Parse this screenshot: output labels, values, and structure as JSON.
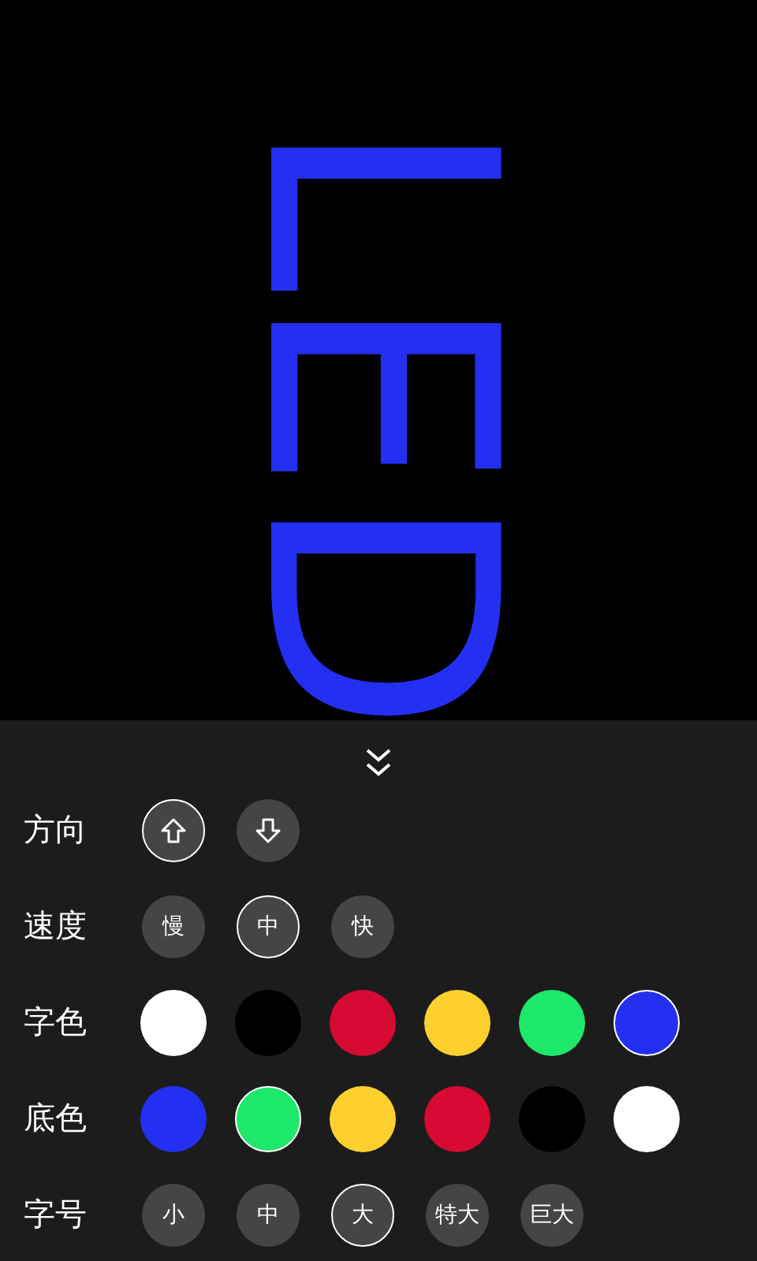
{
  "marquee": {
    "text": "LED",
    "color": "#2330f2"
  },
  "rows": [
    {
      "label": "方向",
      "kind": "arrows",
      "options": [
        {
          "kind": "up",
          "selected": true
        },
        {
          "kind": "down",
          "selected": false
        }
      ]
    },
    {
      "label": "速度",
      "kind": "text",
      "options": [
        {
          "text": "慢",
          "selected": false
        },
        {
          "text": "中",
          "selected": true
        },
        {
          "text": "快",
          "selected": false
        }
      ]
    },
    {
      "label": "字色",
      "kind": "colors",
      "options": [
        {
          "color": "#ffffff",
          "selected": false
        },
        {
          "color": "#000000",
          "selected": false
        },
        {
          "color": "#d60a32",
          "selected": false
        },
        {
          "color": "#fdd02e",
          "selected": false
        },
        {
          "color": "#1ee86a",
          "selected": false
        },
        {
          "color": "#2330f2",
          "selected": true
        }
      ]
    },
    {
      "label": "底色",
      "kind": "colors",
      "options": [
        {
          "color": "#2330f2",
          "selected": false
        },
        {
          "color": "#1ee86a",
          "selected": true
        },
        {
          "color": "#fdd02e",
          "selected": false
        },
        {
          "color": "#d60a32",
          "selected": false
        },
        {
          "color": "#000000",
          "selected": false
        },
        {
          "color": "#ffffff",
          "selected": false
        }
      ]
    },
    {
      "label": "字号",
      "kind": "text",
      "options": [
        {
          "text": "小",
          "selected": false
        },
        {
          "text": "中",
          "selected": false
        },
        {
          "text": "大",
          "selected": true
        },
        {
          "text": "特大",
          "selected": false
        },
        {
          "text": "巨大",
          "selected": false
        }
      ]
    }
  ]
}
